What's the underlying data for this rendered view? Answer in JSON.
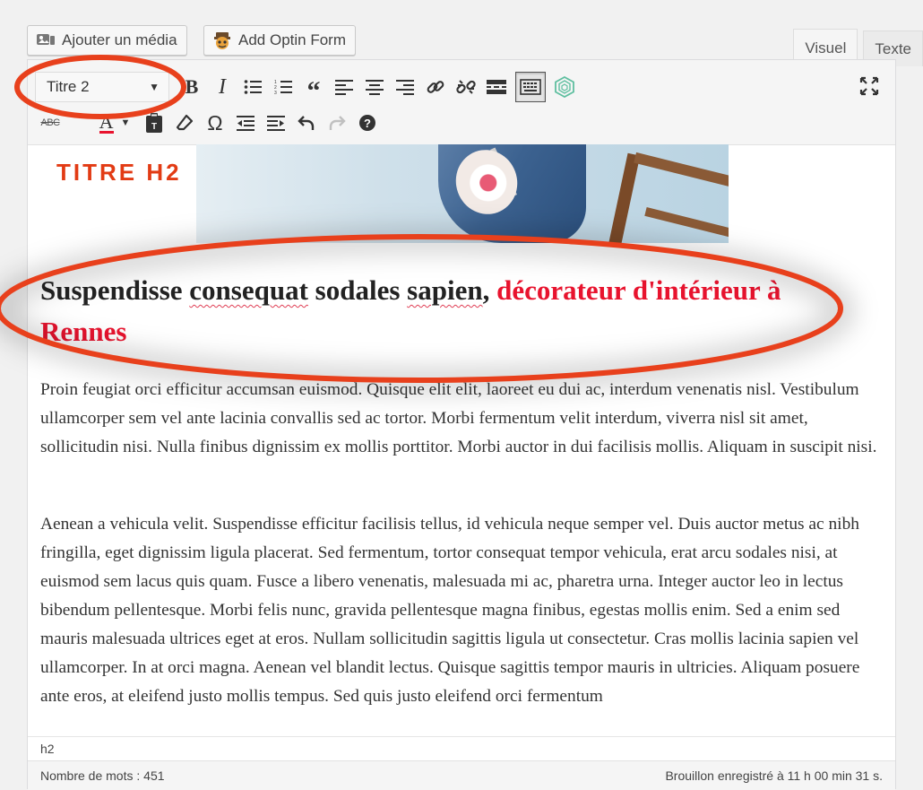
{
  "toolbar_top": {
    "add_media_label": "Ajouter un média",
    "add_optin_label": "Add Optin Form",
    "tabs": [
      {
        "label": "Visuel"
      },
      {
        "label": "Texte"
      }
    ]
  },
  "format_select": {
    "value": "Titre 2"
  },
  "editor": {
    "banner_title": "TITRE H2",
    "heading": {
      "words": [
        {
          "text": "Suspendisse",
          "spell": false
        },
        {
          "text": "consequat",
          "spell": true
        },
        {
          "text": "sodales",
          "spell": false
        },
        {
          "text": "sapien",
          "spell": true
        }
      ],
      "comma": ",",
      "highlight": "décorateur d'intérieur à Rennes"
    },
    "paragraphs": [
      "Proin feugiat orci efficitur accumsan euismod. Quisque elit elit, laoreet eu dui ac, interdum venenatis nisl. Vestibulum ullamcorper sem vel ante lacinia convallis sed ac tortor. Morbi fermentum velit interdum, viverra nisl sit amet, sollicitudin nisi. Nulla finibus dignissim ex mollis porttitor. Morbi auctor in dui facilisis mollis. Aliquam in suscipit nisi.",
      "Aenean a vehicula velit. Suspendisse efficitur facilisis tellus, id vehicula neque semper vel. Duis auctor metus ac nibh fringilla, eget dignissim ligula placerat. Sed fermentum, tortor consequat tempor vehicula, erat arcu sodales nisi, at euismod sem lacus quis quam. Fusce a libero venenatis, malesuada mi ac, pharetra urna. Integer auctor leo in lectus bibendum pellentesque. Morbi felis nunc, gravida pellentesque magna finibus, egestas mollis enim. Sed a enim sed mauris malesuada ultrices eget at eros. Nullam sollicitudin sagittis ligula ut consectetur. Cras mollis lacinia sapien vel ullamcorper. In at orci magna. Aenean vel blandit lectus. Quisque sagittis tempor mauris in ultricies. Aliquam posuere ante eros, at eleifend justo mollis tempus. Sed quis justo eleifend orci fermentum"
    ]
  },
  "statusbar": {
    "path": "h2",
    "word_count": "Nombre de mots : 451",
    "saved": "Brouillon enregistré à 11 h 00 min 31 s."
  },
  "colors": {
    "annotation": "#e8401c",
    "heading_accent": "#e8132e",
    "banner_title": "#e23b14"
  }
}
